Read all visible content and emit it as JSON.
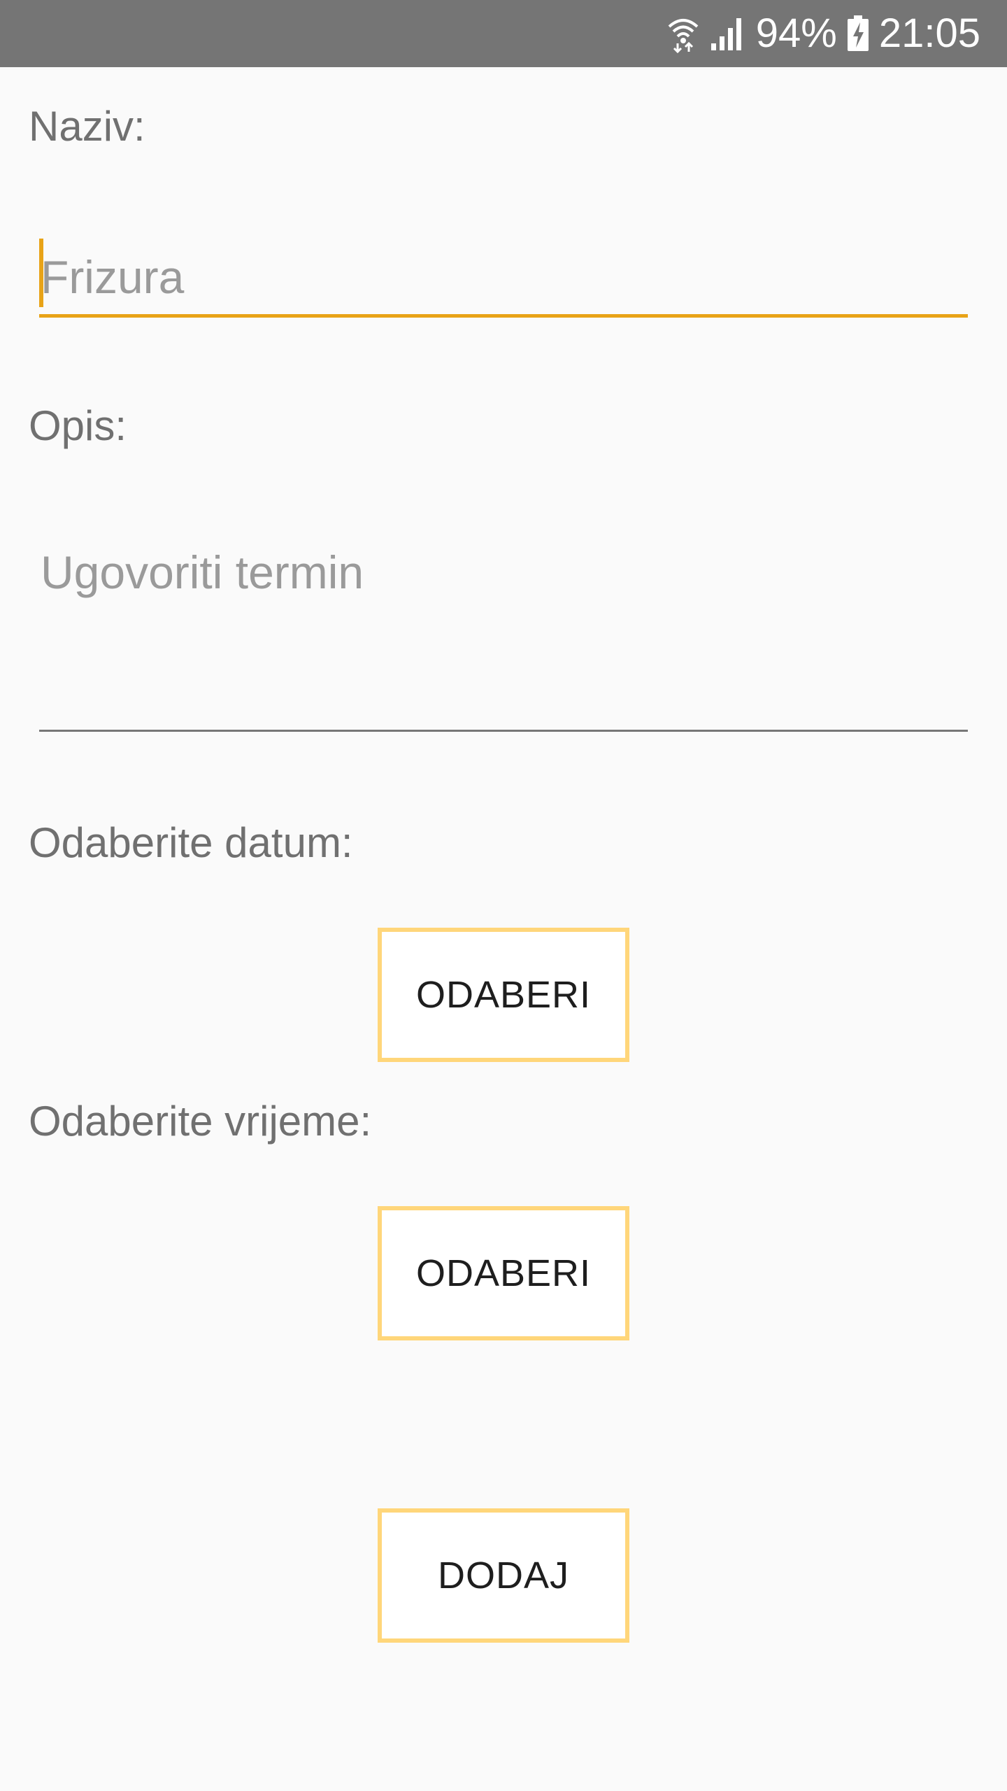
{
  "status_bar": {
    "battery": "94%",
    "time": "21:05",
    "icons": [
      "wifi-icon",
      "signal-icon",
      "battery-charging-icon"
    ]
  },
  "form": {
    "naziv_label": "Naziv:",
    "naziv_placeholder": "Frizura",
    "opis_label": "Opis:",
    "opis_placeholder": "Ugovoriti termin",
    "datum_label": "Odaberite datum:",
    "datum_button": "ODABERI",
    "vrijeme_label": "Odaberite vrijeme:",
    "vrijeme_button": "ODABERI",
    "dodaj_button": "DODAJ"
  },
  "colors": {
    "status_bar": "#757575",
    "accent": "#e8a317",
    "button_border": "#ffd67a",
    "background": "#fafafa"
  }
}
